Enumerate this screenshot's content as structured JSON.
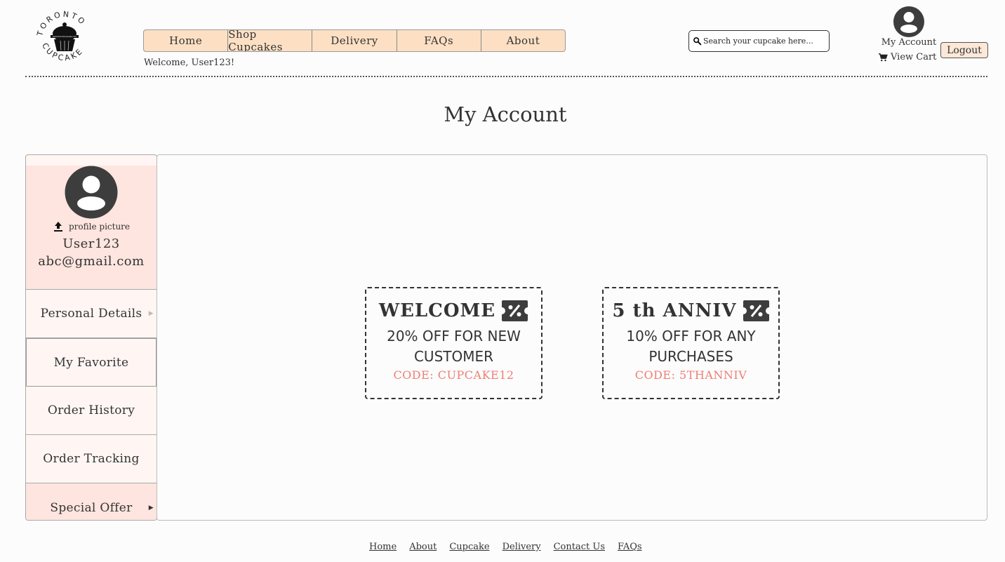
{
  "brand": {
    "logo_top_text": "TORONTO",
    "logo_bottom_text": "CUPCAKE",
    "logo_url_text": "www.TorontoCupcake.com"
  },
  "nav": {
    "items": [
      {
        "label": "Home"
      },
      {
        "label": "Shop Cupcakes"
      },
      {
        "label": "Delivery"
      },
      {
        "label": "FAQs"
      },
      {
        "label": "About"
      }
    ]
  },
  "welcome_text": "Welcome, User123!",
  "search": {
    "placeholder": "Search your cupcake here..."
  },
  "header_account": {
    "my_account_label": "My Account",
    "view_cart_label": "View Cart",
    "logout_label": "Logout"
  },
  "page_title": "My Account",
  "profile": {
    "upload_label": "profile picture",
    "username": "User123",
    "email": "abc@gmail.com"
  },
  "sidebar": {
    "items": [
      {
        "label": "Personal Details"
      },
      {
        "label": "My Favorite"
      },
      {
        "label": "Order History"
      },
      {
        "label": "Order Tracking"
      },
      {
        "label": "Special Offer"
      }
    ]
  },
  "coupons": [
    {
      "title": "WELCOME",
      "line1": "20% OFF FOR NEW",
      "line2": "CUSTOMER",
      "code": "CODE: CUPCAKE12"
    },
    {
      "title": "5 th ANNIV",
      "line1": "10% OFF FOR ANY",
      "line2": "PURCHASES",
      "code": "CODE: 5THANNIV"
    }
  ],
  "footer": {
    "links": [
      {
        "label": "Home"
      },
      {
        "label": "About"
      },
      {
        "label": "Cupcake"
      },
      {
        "label": "Delivery"
      },
      {
        "label": "Contact Us"
      },
      {
        "label": "FAQs"
      }
    ]
  },
  "icons": {
    "avatar": "account-circle-icon",
    "cart": "shopping-cart-icon",
    "search": "search-icon",
    "upload": "upload-icon",
    "coupon": "discount-ticket-icon"
  },
  "colors": {
    "nav_bg": "#fde0c4",
    "sidebar_profile_bg": "#fee5df",
    "coupon_code": "#f07e73"
  }
}
